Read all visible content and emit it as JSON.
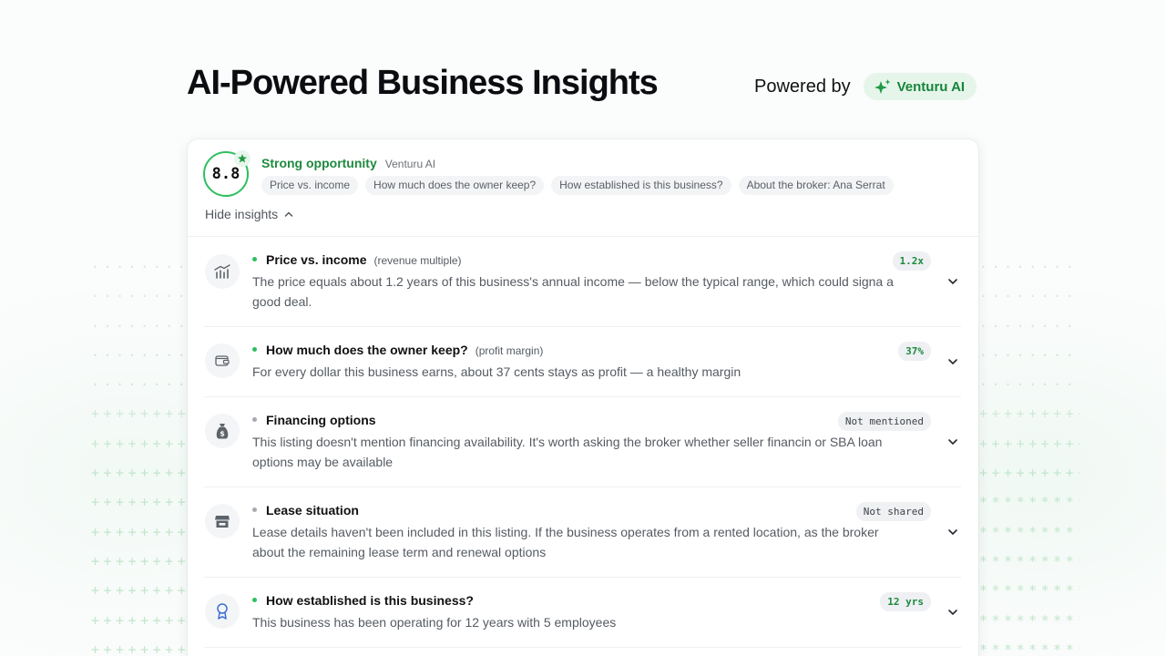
{
  "hero": {
    "title": "AI-Powered Business Insights",
    "powered_label": "Powered by",
    "brand": "Venturu AI"
  },
  "summary": {
    "score": "8.8",
    "verdict": "Strong opportunity",
    "source": "Venturu AI",
    "chips": [
      "Price vs. income",
      "How much does the owner keep?",
      "How established is this business?",
      "About the broker: Ana Serrat"
    ],
    "hide_label": "Hide insights"
  },
  "insights": [
    {
      "title": "Price vs. income",
      "subtitle": "(revenue multiple)",
      "description": "The price equals about 1.2 years of this business's annual income — below the typical range, which could signa a good deal.",
      "badge": "1.2x",
      "status": "green",
      "icon": "chart-icon"
    },
    {
      "title": "How much does the owner keep?",
      "subtitle": "(profit margin)",
      "description": "For every dollar this business earns, about 37 cents stays as profit — a healthy margin",
      "badge": "37%",
      "status": "green",
      "icon": "wallet-icon"
    },
    {
      "title": "Financing options",
      "subtitle": "",
      "description": "This listing doesn't mention financing availability. It's worth asking the broker whether seller financin or SBA loan options may be available",
      "badge": "Not mentioned",
      "status": "gray",
      "icon": "money-bag-icon"
    },
    {
      "title": "Lease situation",
      "subtitle": "",
      "description": "Lease details haven't been included in this listing. If the business operates from a rented location, as the broker about the remaining lease term and renewal options",
      "badge": "Not shared",
      "status": "gray",
      "icon": "storefront-icon"
    },
    {
      "title": "How established is this business?",
      "subtitle": "",
      "description": "This business has been operating for 12 years with 5 employees",
      "badge": "12 yrs",
      "status": "green",
      "icon": "award-icon"
    }
  ],
  "colors": {
    "accent_green": "#1e8a3e",
    "ring_green": "#2fbf5f",
    "badge_bg": "#e6f5ea"
  }
}
